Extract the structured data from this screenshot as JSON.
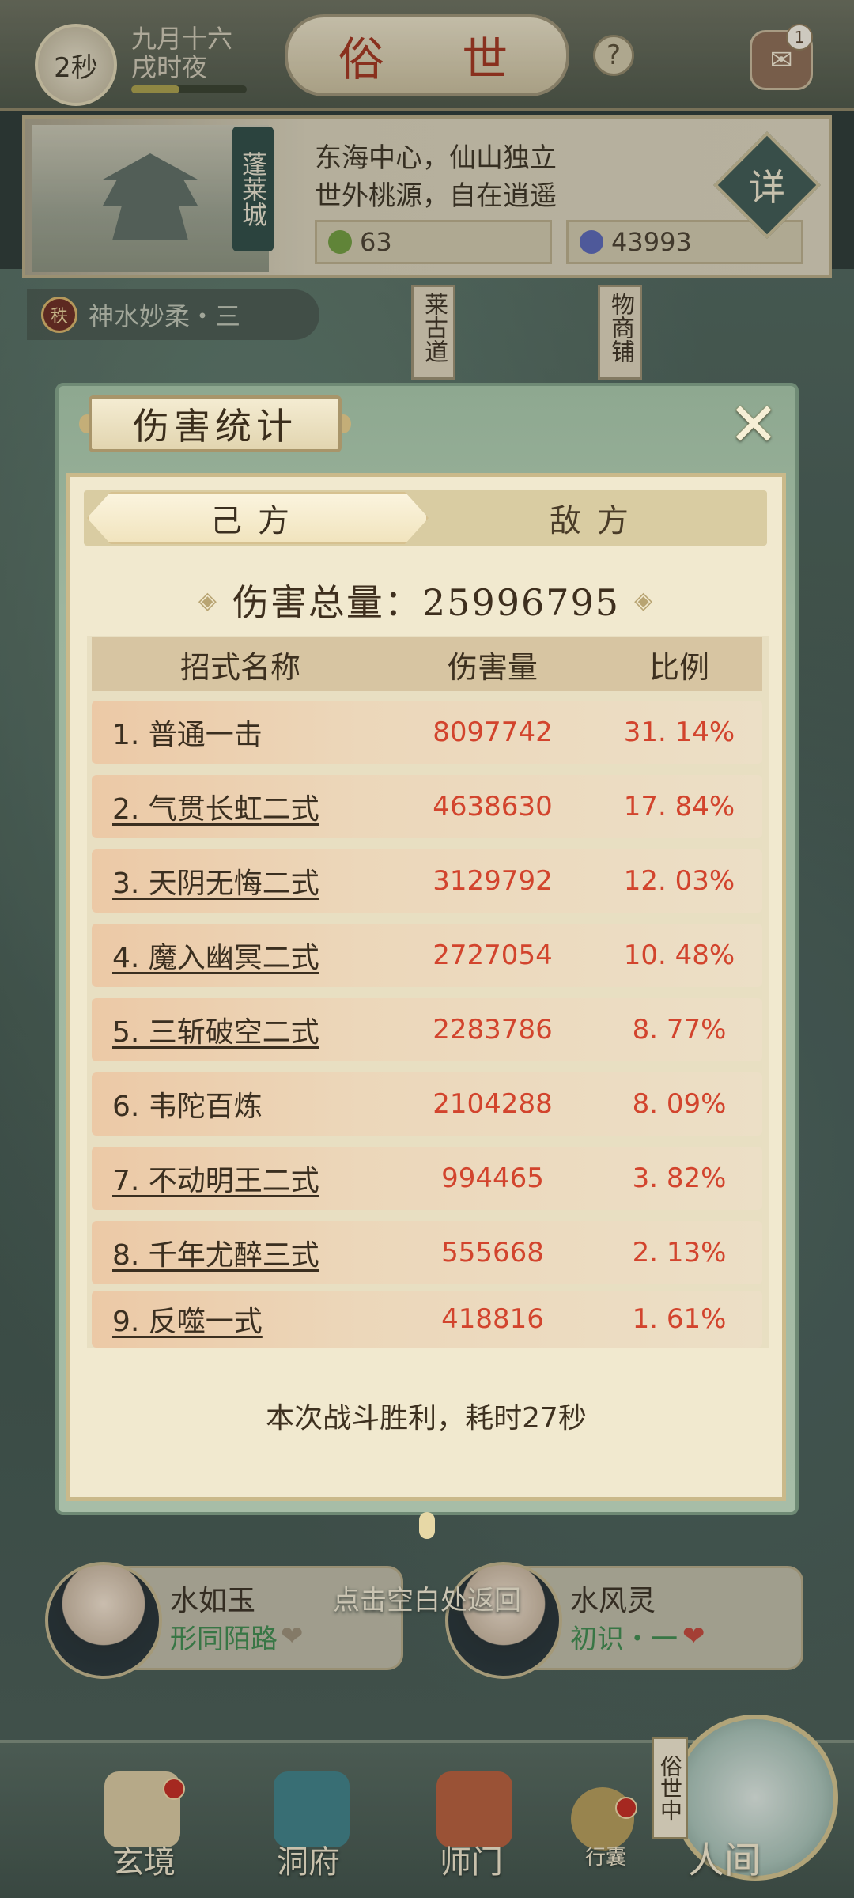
{
  "status": {
    "timer": "2秒",
    "date_line1": "九月十六",
    "date_line2": "戌时夜",
    "progress": 0.42
  },
  "header": {
    "title": "俗 世",
    "help": "?",
    "chat_badge": "1"
  },
  "city": {
    "name": "蓬莱城",
    "desc_line1": "东海中心，仙山独立",
    "desc_line2": "世外桃源，自在逍遥",
    "resource1": "63",
    "resource2": "43993",
    "detail_label": "详"
  },
  "quest": {
    "badge": "秩",
    "text": "神水妙柔・三"
  },
  "map_signs": {
    "sign1": "莱古道",
    "sign2": "物商铺"
  },
  "modal": {
    "title": "伤害统计",
    "close": "✕",
    "tab_own": "己方",
    "tab_enemy": "敌方",
    "total_label": "伤害总量：25996795",
    "columns": {
      "name": "招式名称",
      "damage": "伤害量",
      "ratio": "比例"
    },
    "rows": [
      {
        "name": "1. 普通一击",
        "damage": "8097742",
        "ratio": "31. 14%"
      },
      {
        "name": "2. 气贯长虹二式",
        "damage": "4638630",
        "ratio": "17. 84%"
      },
      {
        "name": "3. 天阴无悔二式",
        "damage": "3129792",
        "ratio": "12. 03%"
      },
      {
        "name": "4. 魔入幽冥二式",
        "damage": "2727054",
        "ratio": "10. 48%"
      },
      {
        "name": "5. 三斩破空二式",
        "damage": "2283786",
        "ratio": "8. 77%"
      },
      {
        "name": "6. 韦陀百炼",
        "damage": "2104288",
        "ratio": "8. 09%"
      },
      {
        "name": "7. 不动明王二式",
        "damage": "994465",
        "ratio": "3. 82%"
      },
      {
        "name": "8. 千年尤醉三式",
        "damage": "555668",
        "ratio": "2. 13%"
      },
      {
        "name": "9. 反噬一式",
        "damage": "418816",
        "ratio": "1. 61%"
      }
    ],
    "result": "本次战斗胜利，耗时27秒"
  },
  "return_hint": "点击空白处返回",
  "npcs": [
    {
      "name": "水如玉",
      "relation": "形同陌路",
      "heart_color": "#9c8f78"
    },
    {
      "name": "水风灵",
      "relation": "初识・一",
      "heart_color": "#c3473b"
    }
  ],
  "bottom_nav": {
    "item1": "玄境",
    "item2": "洞府",
    "item3": "师门",
    "item4": "行囊",
    "world": "人间",
    "world_tag": "俗世中"
  },
  "colors": {
    "accent_red": "#d2442d",
    "relation_green": "#3f8a4f"
  }
}
